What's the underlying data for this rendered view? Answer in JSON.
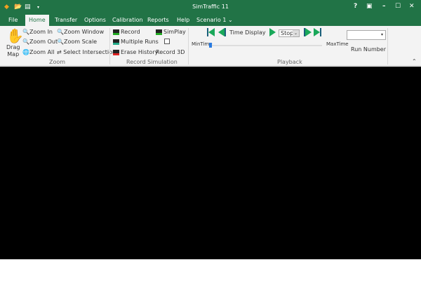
{
  "window": {
    "title": "SimTraffic 11",
    "help": "?",
    "restore": "▣",
    "minimize": "–",
    "maximize": "☐",
    "close": "✕"
  },
  "tabs": [
    "File",
    "Home",
    "Transfer",
    "Options",
    "Calibration",
    "Reports",
    "Help"
  ],
  "scenario": "Scenario 1",
  "zoom": {
    "drag": "Drag",
    "map": "Map",
    "zoom_in": "Zoom In",
    "zoom_out": "Zoom Out",
    "zoom_all": "Zoom All",
    "zoom_window": "Zoom Window",
    "zoom_scale": "Zoom Scale",
    "select_intersection": "Select Intersection",
    "group": "Zoom"
  },
  "record": {
    "record": "Record",
    "multiple_runs": "Multiple Runs",
    "erase_history": "Erase History",
    "simplay": "SimPlay",
    "record3d": "Record 3D",
    "record3d_checked": false,
    "group": "Record Simulation"
  },
  "playback": {
    "time_display": "Time Display",
    "speed": "Stop",
    "min": "MinTime",
    "max": "MaxTime",
    "slider_position": 0,
    "group": "Playback"
  },
  "run_number": {
    "label": "Run Number",
    "value": ""
  }
}
